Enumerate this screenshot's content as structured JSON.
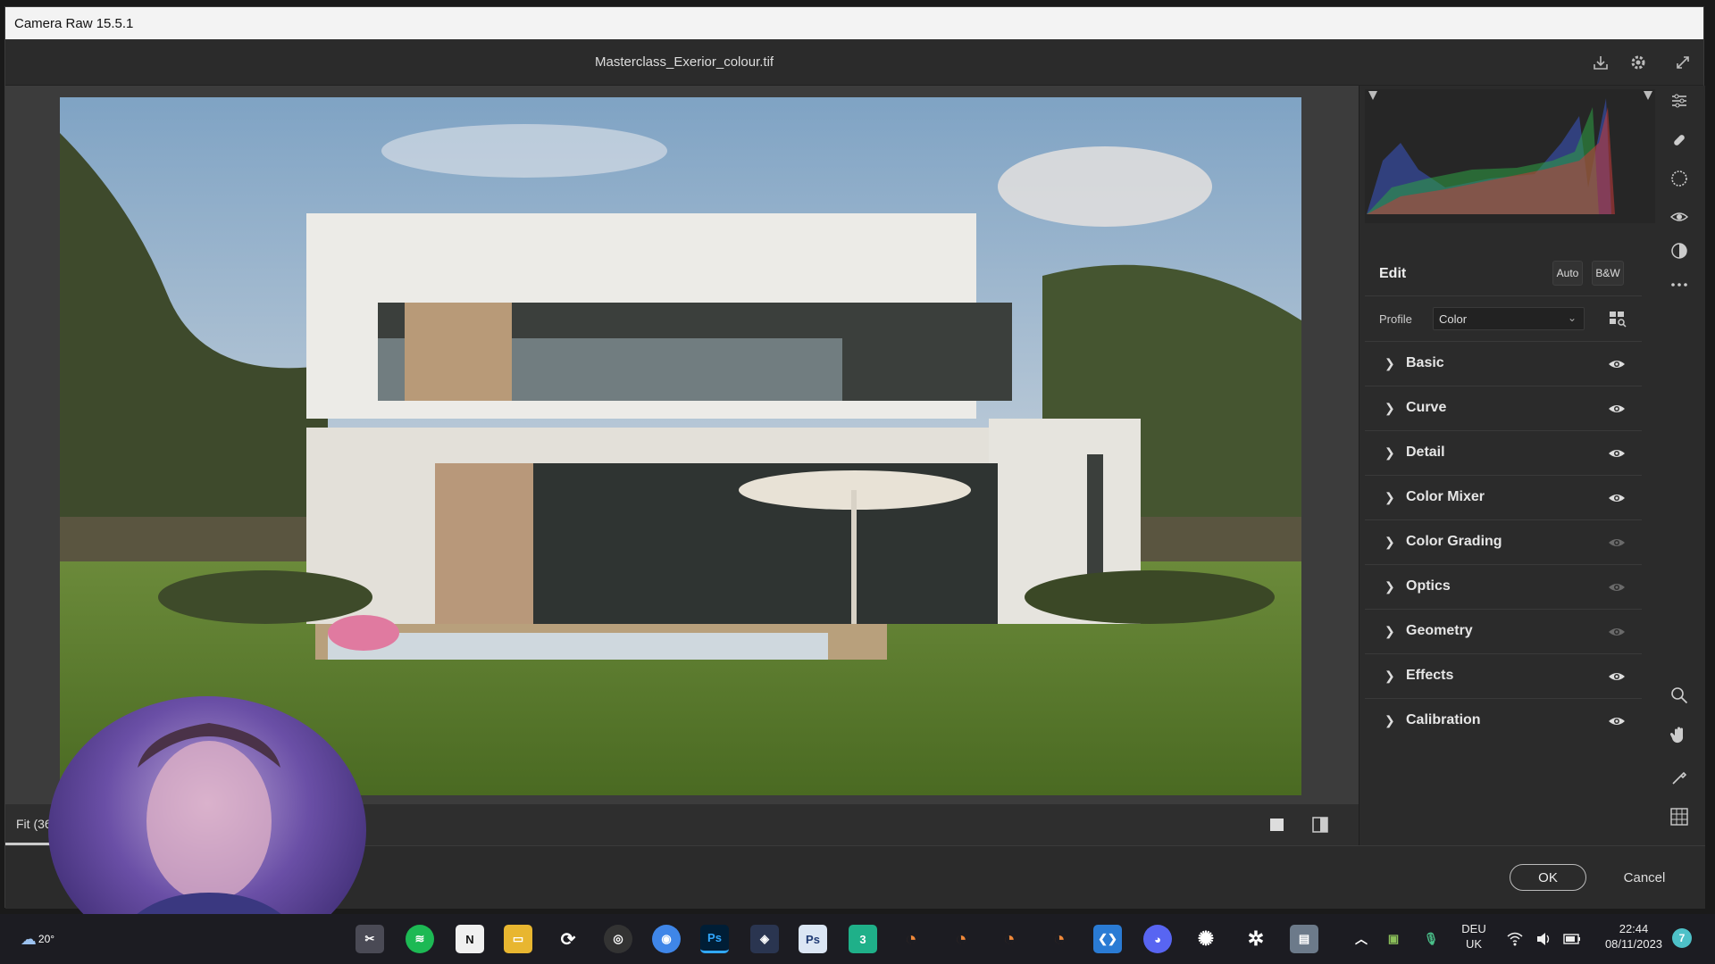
{
  "window": {
    "title": "Camera Raw 15.5.1"
  },
  "document": {
    "filename": "Masterclass_Exerior_colour.tif"
  },
  "header_tools": [
    "save-icon",
    "gear-icon",
    "fullscreen-icon"
  ],
  "canvas": {
    "zoom_label": "Fit (36"
  },
  "edit": {
    "title": "Edit",
    "auto_label": "Auto",
    "bw_label": "B&W",
    "profile_label": "Profile",
    "profile_value": "Color",
    "sections": [
      {
        "label": "Basic",
        "visible": true
      },
      {
        "label": "Curve",
        "visible": true
      },
      {
        "label": "Detail",
        "visible": true
      },
      {
        "label": "Color Mixer",
        "visible": true
      },
      {
        "label": "Color Grading",
        "visible": false
      },
      {
        "label": "Optics",
        "visible": false
      },
      {
        "label": "Geometry",
        "visible": false
      },
      {
        "label": "Effects",
        "visible": true
      },
      {
        "label": "Calibration",
        "visible": true
      }
    ]
  },
  "tool_strip": [
    "edit-sliders-icon",
    "healing-icon",
    "masking-icon",
    "red-eye-icon",
    "presets-icon",
    "more-icon",
    "zoom-icon",
    "hand-icon",
    "eyedropper-icon",
    "grid-icon"
  ],
  "actions": {
    "ok_label": "OK",
    "cancel_label": "Cancel"
  },
  "taskbar": {
    "weather": "20°",
    "language": "DEU",
    "region": "UK",
    "time": "22:44",
    "date": "08/11/2023",
    "notification_count": "7"
  },
  "colors": {
    "accent": "#1473e6",
    "panel_bg": "#2b2b2b",
    "canvas_bg": "#3c3c3c"
  }
}
